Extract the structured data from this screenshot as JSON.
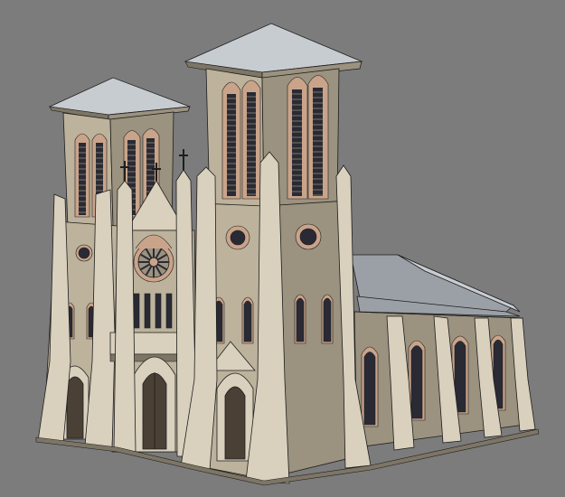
{
  "scene": {
    "subject": "gothic-cathedral-3d-model",
    "colors": {
      "background": "#7c7c7c",
      "stone_light": "#d9d0bd",
      "stone_mid": "#bdb29c",
      "stone_shadow": "#9b927f",
      "stone_dark": "#7d7565",
      "edge_line": "#1e1e1e",
      "roof": "#9aa0a6",
      "roof_light": "#c7ccd1",
      "window_dark": "#2a2a35",
      "window_red": "#6a2a2a",
      "door_dark": "#4a4036",
      "window_trim": "#c9a48a"
    }
  }
}
